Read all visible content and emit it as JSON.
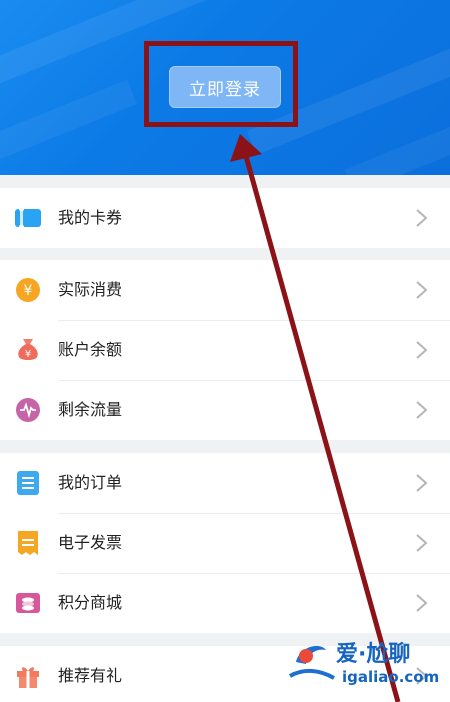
{
  "header": {
    "login_label": "立即登录",
    "accent": "#0c7ae6"
  },
  "groups": [
    {
      "items": [
        {
          "label": "我的卡券",
          "icon": "coupon-icon"
        }
      ]
    },
    {
      "items": [
        {
          "label": "实际消费",
          "icon": "yuan-coin-icon"
        },
        {
          "label": "账户余额",
          "icon": "money-bag-icon"
        },
        {
          "label": "剩余流量",
          "icon": "data-traffic-icon"
        }
      ]
    },
    {
      "items": [
        {
          "label": "我的订单",
          "icon": "order-list-icon"
        },
        {
          "label": "电子发票",
          "icon": "invoice-icon"
        },
        {
          "label": "积分商城",
          "icon": "points-mall-icon"
        }
      ]
    },
    {
      "items": [
        {
          "label": "推荐有礼",
          "icon": "gift-icon"
        }
      ]
    }
  ],
  "watermark": {
    "top_text": "爱·尬聊",
    "bottom_text": "igaliao.com"
  },
  "annotation_color": "#8b1318"
}
